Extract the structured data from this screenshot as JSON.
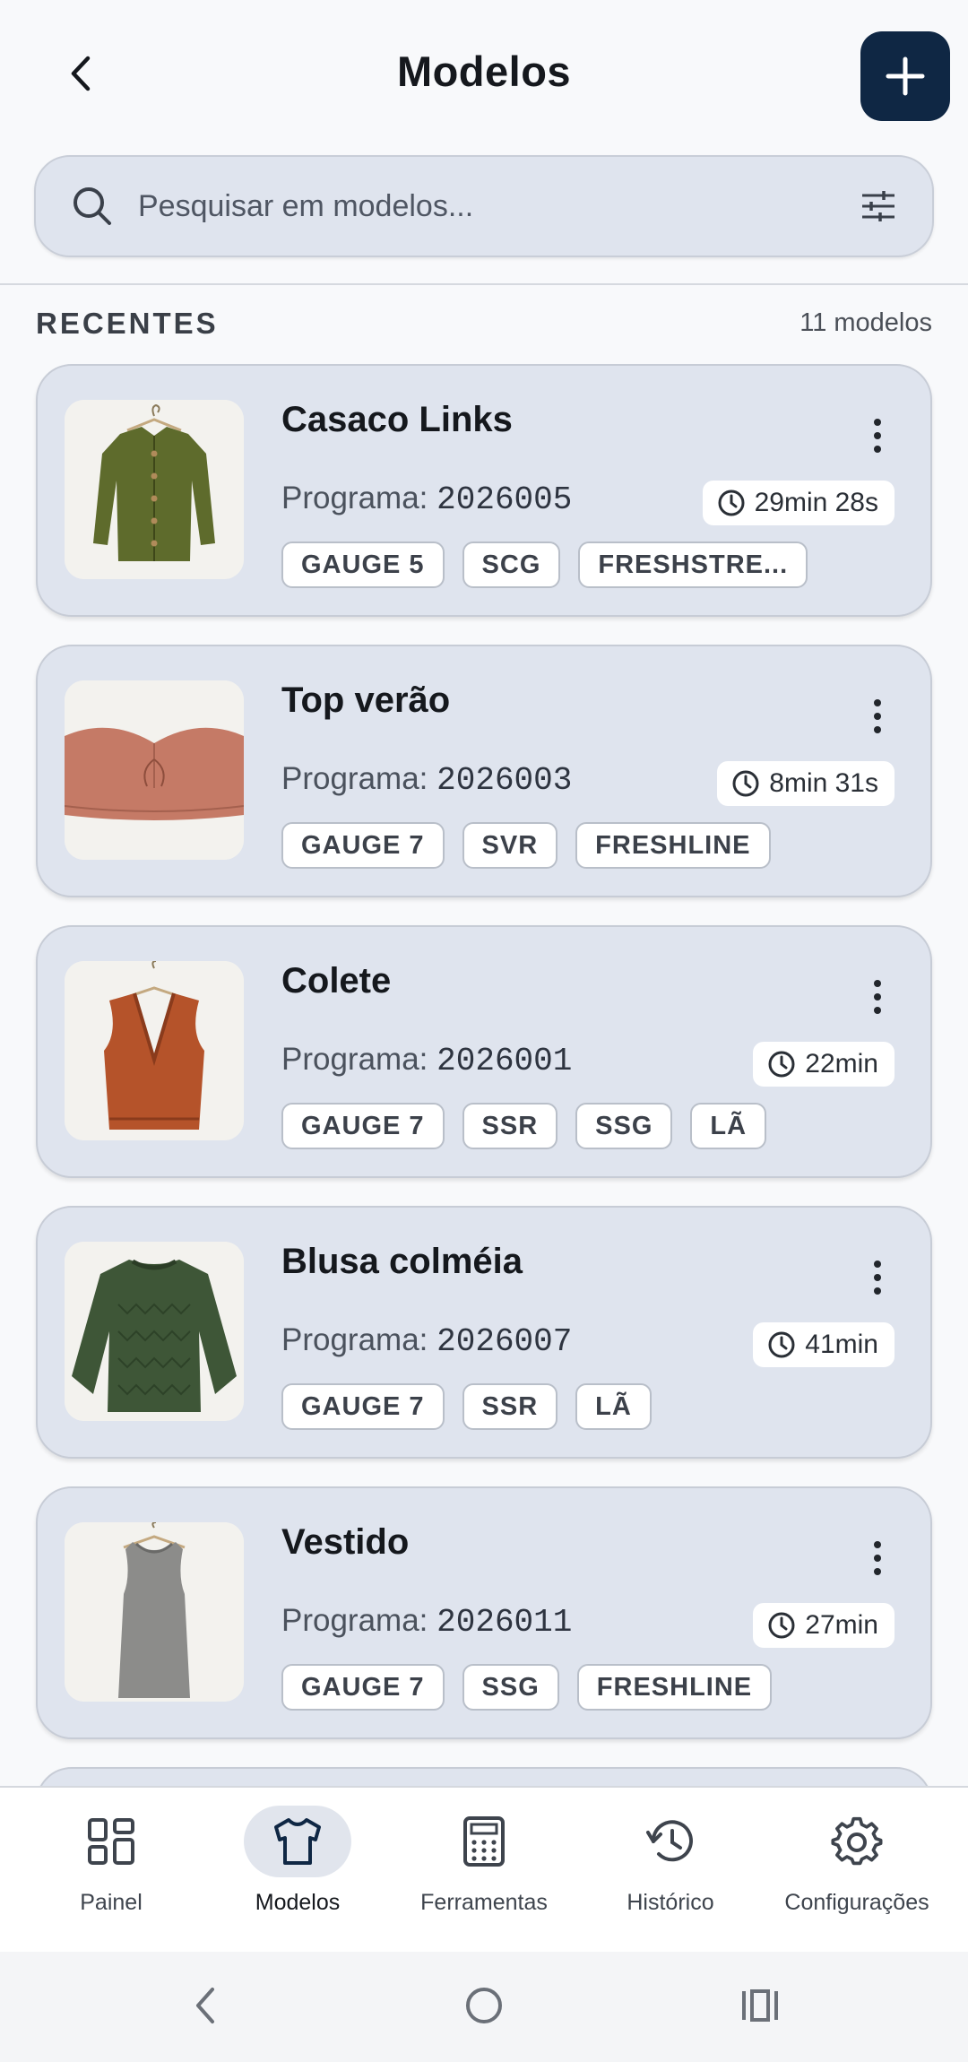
{
  "header": {
    "title": "Modelos"
  },
  "search": {
    "placeholder": "Pesquisar em modelos..."
  },
  "section": {
    "title": "RECENTES",
    "count": "11 modelos"
  },
  "models": [
    {
      "name": "Casaco Links",
      "program_label": "Programa:",
      "program_code": "2026005",
      "time": "29min 28s",
      "tags": [
        "GAUGE 5",
        "SCG",
        "FRESHSTRE..."
      ],
      "garment": "cardigan",
      "color": "#5e6b2c"
    },
    {
      "name": "Top verão",
      "program_label": "Programa:",
      "program_code": "2026003",
      "time": "8min 31s",
      "tags": [
        "GAUGE 7",
        "SVR",
        "FRESHLINE"
      ],
      "garment": "tube-top",
      "color": "#c57a66"
    },
    {
      "name": "Colete",
      "program_label": "Programa:",
      "program_code": "2026001",
      "time": "22min",
      "tags": [
        "GAUGE 7",
        "SSR",
        "SSG",
        "LÃ"
      ],
      "garment": "vest",
      "color": "#b5532a"
    },
    {
      "name": "Blusa colméia",
      "program_label": "Programa:",
      "program_code": "2026007",
      "time": "41min",
      "tags": [
        "GAUGE 7",
        "SSR",
        "LÃ"
      ],
      "garment": "sweater",
      "color": "#3e5637"
    },
    {
      "name": "Vestido",
      "program_label": "Programa:",
      "program_code": "2026011",
      "time": "27min",
      "tags": [
        "GAUGE 7",
        "SSG",
        "FRESHLINE"
      ],
      "garment": "dress",
      "color": "#8c8c8a"
    }
  ],
  "nav": {
    "items": [
      {
        "label": "Painel",
        "icon": "grid-icon",
        "active": false
      },
      {
        "label": "Modelos",
        "icon": "shirt-icon",
        "active": true
      },
      {
        "label": "Ferramentas",
        "icon": "calculator-icon",
        "active": false
      },
      {
        "label": "Histórico",
        "icon": "history-icon",
        "active": false
      },
      {
        "label": "Configurações",
        "icon": "gear-icon",
        "active": false
      }
    ]
  },
  "colors": {
    "accent": "#0f2744",
    "card": "#dfe4ee",
    "chip": "#ffffff"
  }
}
